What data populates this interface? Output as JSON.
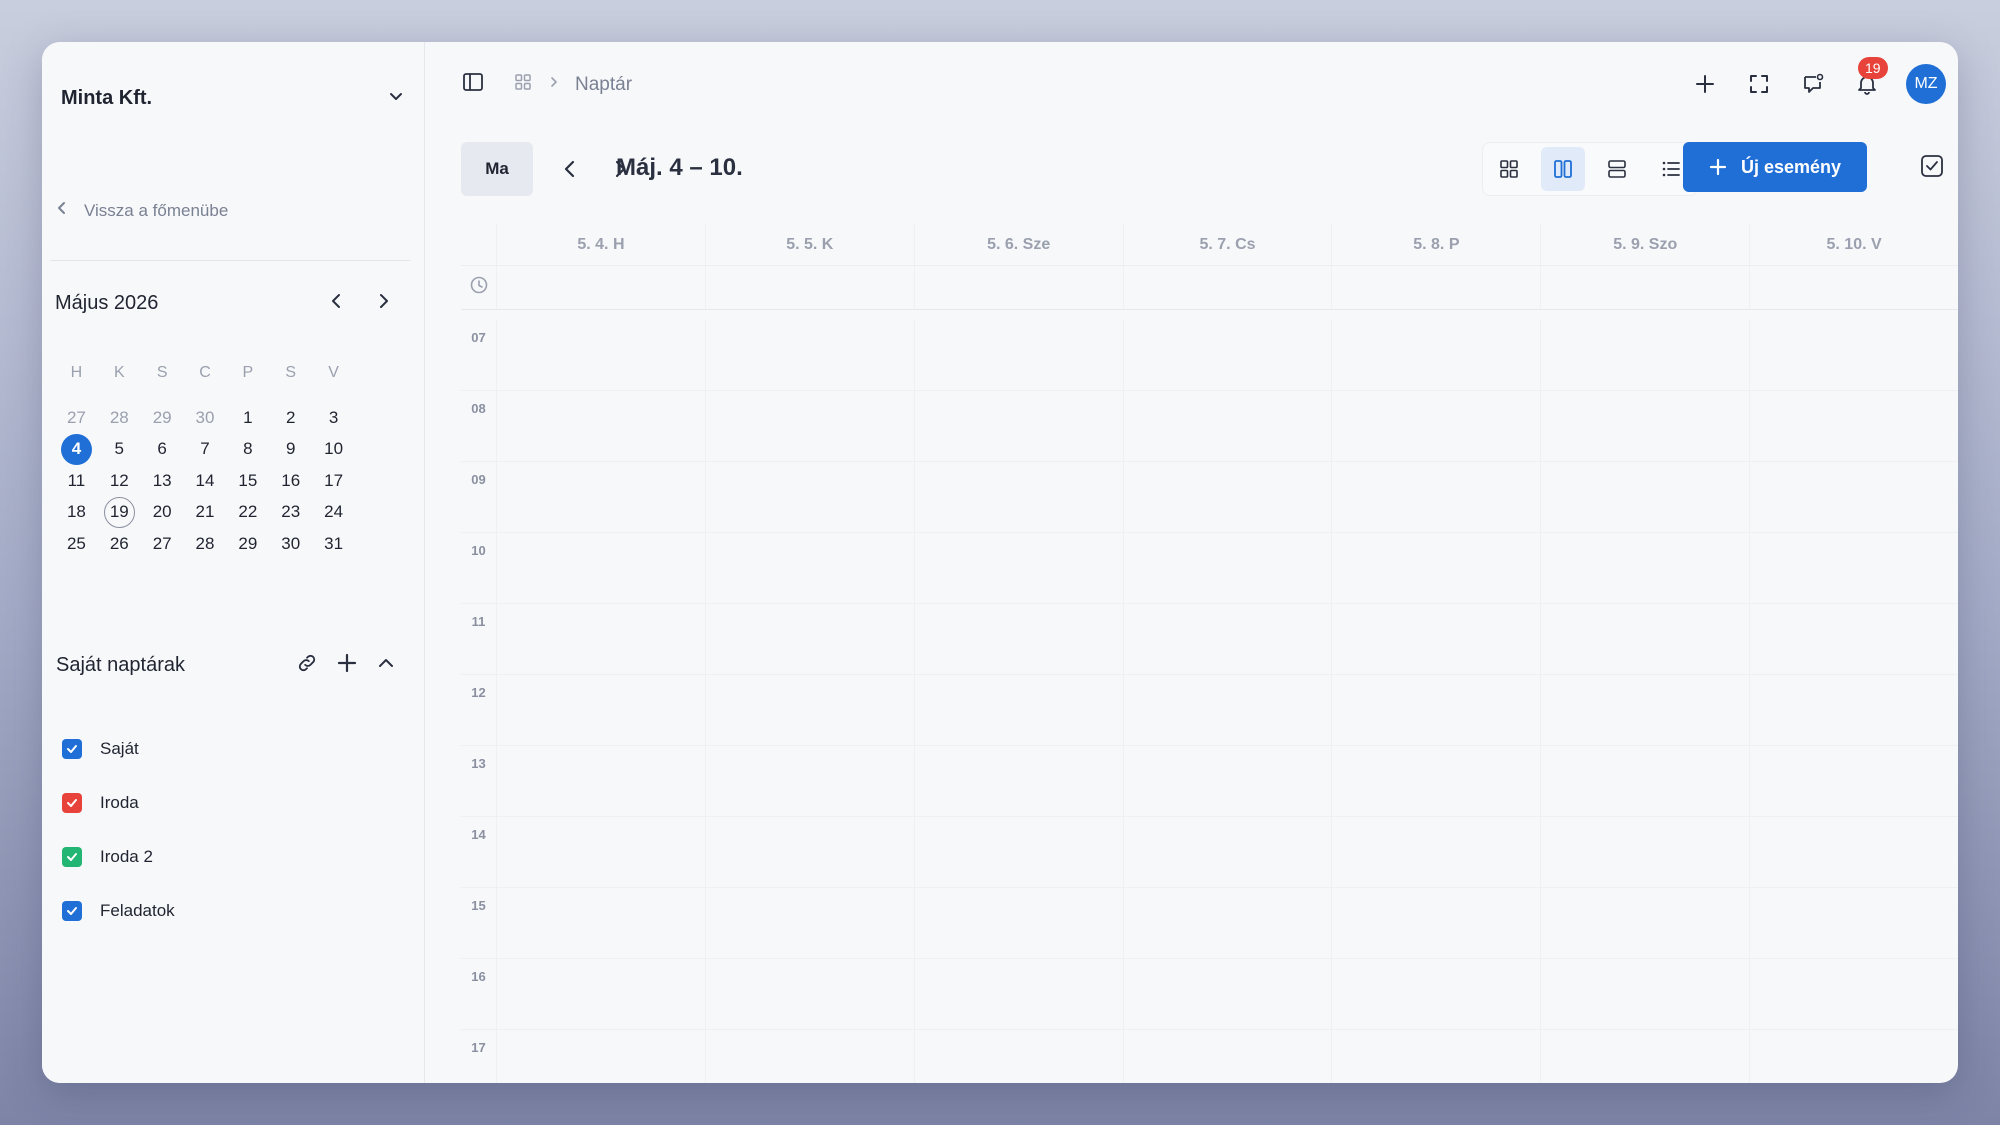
{
  "org": {
    "name": "Minta Kft."
  },
  "back": {
    "label": "Vissza a főmenübe"
  },
  "mini_calendar": {
    "title": "Május 2026",
    "weekdays": [
      "H",
      "K",
      "S",
      "C",
      "P",
      "S",
      "V"
    ],
    "weeks": [
      [
        "27",
        "28",
        "29",
        "30",
        "1",
        "2",
        "3"
      ],
      [
        "4",
        "5",
        "6",
        "7",
        "8",
        "9",
        "10"
      ],
      [
        "11",
        "12",
        "13",
        "14",
        "15",
        "16",
        "17"
      ],
      [
        "18",
        "19",
        "20",
        "21",
        "22",
        "23",
        "24"
      ],
      [
        "25",
        "26",
        "27",
        "28",
        "29",
        "30",
        "31"
      ]
    ],
    "selected": "4",
    "today": "19"
  },
  "calendars": {
    "title": "Saját naptárak",
    "items": [
      {
        "label": "Saját",
        "color": "#1f6fd6"
      },
      {
        "label": "Iroda",
        "color": "#e8433a"
      },
      {
        "label": "Iroda 2",
        "color": "#22b573"
      },
      {
        "label": "Feladatok",
        "color": "#1f6fd6"
      }
    ]
  },
  "breadcrumb": {
    "label": "Naptár"
  },
  "notifications": {
    "count": "19"
  },
  "user": {
    "initials": "MZ"
  },
  "toolbar": {
    "today_label": "Ma",
    "range": "Máj. 4 – 10.",
    "new_event_label": "Új esemény"
  },
  "days": [
    "5. 4. H",
    "5. 5. K",
    "5. 6. Sze",
    "5. 7. Cs",
    "5. 8. P",
    "5. 9. Szo",
    "5. 10. V"
  ],
  "hours": [
    "07",
    "08",
    "09",
    "10",
    "11",
    "12",
    "13",
    "14",
    "15",
    "16",
    "17"
  ],
  "colors": {
    "accent": "#1f6fd6",
    "badge": "#e8433a"
  }
}
